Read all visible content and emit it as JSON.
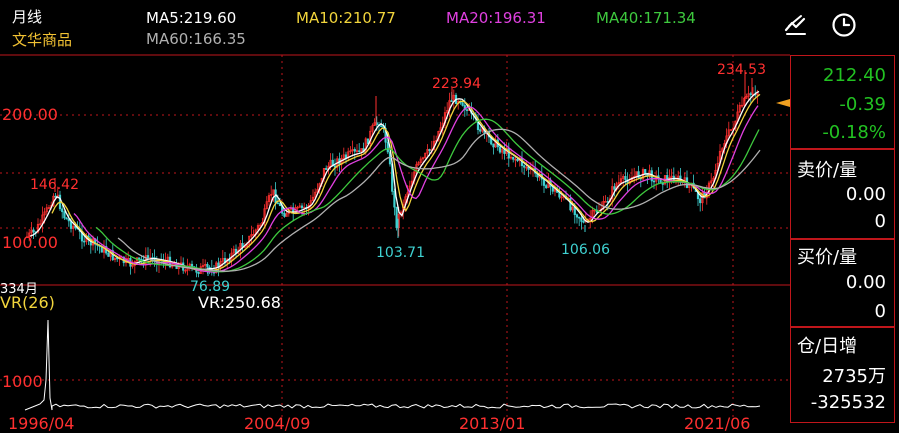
{
  "header": {
    "period": "月线",
    "instrument": "文华商品",
    "ma": [
      {
        "label": "MA5:219.60",
        "color": "#ffffff"
      },
      {
        "label": "MA10:210.77",
        "color": "#f2d53c"
      },
      {
        "label": "MA20:196.31",
        "color": "#e040e0"
      },
      {
        "label": "MA40:171.34",
        "color": "#3ec93e"
      },
      {
        "label": "MA60:166.35",
        "color": "#b0b0b0"
      }
    ],
    "icons": [
      "indicator-toggle-icon",
      "clock-icon"
    ]
  },
  "chart": {
    "y_axis_labels": {
      "level_200": "200.00",
      "level_100": "100.00"
    },
    "annotations": {
      "high_2021": "234.53",
      "high_2011": "223.94",
      "peak_1997": "146.42",
      "low_2009": "103.71",
      "low_2016": "106.06",
      "low_2002": "76.89"
    },
    "x_axis_labels": [
      "1996/04",
      "2004/09",
      "2013/01",
      "2021/06"
    ],
    "colors": {
      "up": "#ff3030",
      "down": "#3fd1d1",
      "label_red": "#ff3030",
      "label_cyan": "#3fd1d1"
    }
  },
  "volume": {
    "bar_count": "334月",
    "indicator_name": "VR(26)",
    "indicator_value": "VR:250.68",
    "axis_label": "1000"
  },
  "quote": {
    "price": "212.40",
    "change": "-0.39",
    "change_pct": "-0.18%",
    "ask_label": "卖价/量",
    "ask_price": "0.00",
    "ask_volume": "0",
    "bid_label": "买价/量",
    "bid_price": "0.00",
    "bid_volume": "0",
    "oi_label": "仓/日增",
    "oi_value": "2735万",
    "oi_change": "-325532",
    "price_color": "#22c222"
  }
}
